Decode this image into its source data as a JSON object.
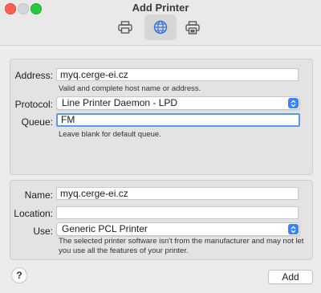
{
  "window": {
    "title": "Add Printer"
  },
  "toolbar": {
    "items": [
      {
        "icon": "printer-icon",
        "active": false
      },
      {
        "icon": "globe-icon",
        "active": true
      },
      {
        "icon": "windows-printer-icon",
        "active": false
      }
    ]
  },
  "connection": {
    "address_label": "Address:",
    "address_value": "myq.cerge-ei.cz",
    "address_hint": "Valid and complete host name or address.",
    "protocol_label": "Protocol:",
    "protocol_value": "Line Printer Daemon - LPD",
    "queue_label": "Queue:",
    "queue_value": "FM",
    "queue_hint": "Leave blank for default queue."
  },
  "printer": {
    "name_label": "Name:",
    "name_value": "myq.cerge-ei.cz",
    "location_label": "Location:",
    "location_value": "",
    "use_label": "Use:",
    "use_value": "Generic PCL Printer",
    "use_warning": "The selected printer software isn't from the manufacturer and may not let you use all the features of your printer."
  },
  "footer": {
    "help_label": "?",
    "add_label": "Add"
  },
  "colors": {
    "accent": "#3a82f7",
    "focus_ring": "#5a9be8",
    "close": "#fe5f57",
    "zoom": "#28c840"
  }
}
